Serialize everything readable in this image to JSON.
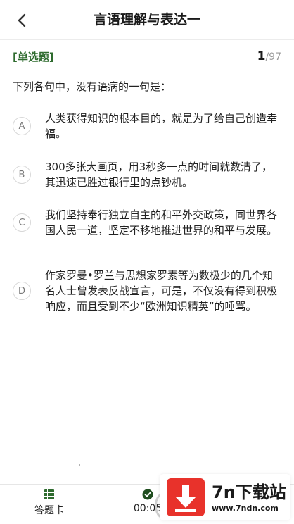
{
  "header": {
    "title": "言语理解与表达一",
    "back_icon": "chevron-left-icon"
  },
  "question": {
    "type_tag": "[单选题]",
    "current": "1",
    "total": "/97",
    "stem": "下列各句中，没有语病的一句是：",
    "options": [
      {
        "letter": "A",
        "text": "人类获得知识的根本目的，就是为了给自己创造幸福。"
      },
      {
        "letter": "B",
        "text": "300多张大画页，用3秒多一点的时间就数清了，其迅速已胜过银行里的点钞机。"
      },
      {
        "letter": "C",
        "text": "我们坚持奉行独立自主的和平外交政策，同世界各国人民一道，坚定不移地推进世界的和平与发展。"
      },
      {
        "letter": "D",
        "text": "作家罗曼•罗兰与思想家罗素等为数极少的几个知名人士曾发表反战宣言，可是，不仅没有得到积极响应，而且受到不少“欧洲知识精英”的唾骂。"
      }
    ]
  },
  "bottom_bar": {
    "answer_sheet_label": "答题卡",
    "answer_sheet_icon": "grid-icon",
    "timer_label": "00:05",
    "timer_icon": "clock-check-icon"
  },
  "watermark": {
    "brand": "7n下载站",
    "url": "www.7ndn.com",
    "icon": "download-arrow-icon",
    "brand_color": "#e8322b"
  },
  "colors": {
    "accent_green": "#2e6b2e",
    "text": "#222222",
    "muted": "#999999"
  }
}
